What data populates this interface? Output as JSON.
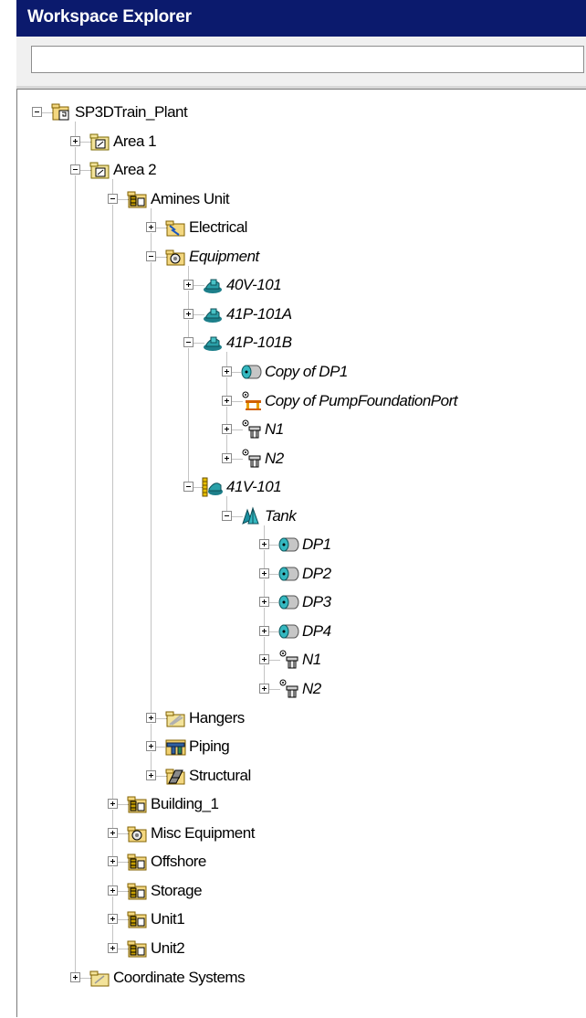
{
  "window": {
    "title": "Workspace Explorer"
  },
  "filter": {
    "value": ""
  },
  "tree": [
    {
      "label": "SP3DTrain_Plant",
      "level": 0,
      "state": "minus",
      "icon": "plant-icon",
      "italic": false
    },
    {
      "label": "Area 1",
      "level": 1,
      "state": "plus",
      "icon": "area-icon",
      "italic": false
    },
    {
      "label": "Area 2",
      "level": 1,
      "state": "minus",
      "icon": "area-icon",
      "italic": false
    },
    {
      "label": "Amines Unit",
      "level": 2,
      "state": "minus",
      "icon": "unit-icon",
      "italic": false
    },
    {
      "label": "Electrical",
      "level": 3,
      "state": "plus",
      "icon": "electrical-folder-icon",
      "italic": false
    },
    {
      "label": "Equipment",
      "level": 3,
      "state": "minus",
      "icon": "equipment-folder-icon",
      "italic": true
    },
    {
      "label": "40V-101",
      "level": 4,
      "state": "plus",
      "icon": "equipment-icon",
      "italic": true
    },
    {
      "label": "41P-101A",
      "level": 4,
      "state": "plus",
      "icon": "equipment-icon",
      "italic": true
    },
    {
      "label": "41P-101B",
      "level": 4,
      "state": "minus",
      "icon": "equipment-icon",
      "italic": true
    },
    {
      "label": "Copy of DP1",
      "level": 5,
      "state": "plus",
      "icon": "design-port-icon",
      "italic": true
    },
    {
      "label": "Copy of PumpFoundationPort",
      "level": 5,
      "state": "plus",
      "icon": "foundation-port-icon",
      "italic": true
    },
    {
      "label": "N1",
      "level": 5,
      "state": "plus",
      "icon": "nozzle-icon",
      "italic": true
    },
    {
      "label": "N2",
      "level": 5,
      "state": "plus",
      "icon": "nozzle-icon",
      "italic": true
    },
    {
      "label": "41V-101",
      "level": 4,
      "state": "minus",
      "icon": "vessel-icon",
      "italic": true
    },
    {
      "label": "Tank",
      "level": 5,
      "state": "minus",
      "icon": "tank-shape-icon",
      "italic": true
    },
    {
      "label": "DP1",
      "level": 6,
      "state": "plus",
      "icon": "design-port-icon",
      "italic": true
    },
    {
      "label": "DP2",
      "level": 6,
      "state": "plus",
      "icon": "design-port-icon",
      "italic": true
    },
    {
      "label": "DP3",
      "level": 6,
      "state": "plus",
      "icon": "design-port-icon",
      "italic": true
    },
    {
      "label": "DP4",
      "level": 6,
      "state": "plus",
      "icon": "design-port-icon",
      "italic": true
    },
    {
      "label": "N1",
      "level": 6,
      "state": "plus",
      "icon": "nozzle-icon",
      "italic": true
    },
    {
      "label": "N2",
      "level": 6,
      "state": "plus",
      "icon": "nozzle-icon",
      "italic": true
    },
    {
      "label": "Hangers",
      "level": 3,
      "state": "plus",
      "icon": "hangers-folder-icon",
      "italic": false
    },
    {
      "label": "Piping",
      "level": 3,
      "state": "plus",
      "icon": "piping-folder-icon",
      "italic": false
    },
    {
      "label": "Structural",
      "level": 3,
      "state": "plus",
      "icon": "structural-folder-icon",
      "italic": false
    },
    {
      "label": "Building_1",
      "level": 2,
      "state": "plus",
      "icon": "unit-icon",
      "italic": false
    },
    {
      "label": "Misc Equipment",
      "level": 2,
      "state": "plus",
      "icon": "equipment-folder-icon",
      "italic": false
    },
    {
      "label": "Offshore",
      "level": 2,
      "state": "plus",
      "icon": "unit-icon",
      "italic": false
    },
    {
      "label": "Storage",
      "level": 2,
      "state": "plus",
      "icon": "unit-icon",
      "italic": false
    },
    {
      "label": "Unit1",
      "level": 2,
      "state": "plus",
      "icon": "unit-icon",
      "italic": false
    },
    {
      "label": "Unit2",
      "level": 2,
      "state": "plus",
      "icon": "unit-icon",
      "italic": false
    },
    {
      "label": "Coordinate Systems",
      "level": 1,
      "state": "plus",
      "icon": "coordinate-folder-icon",
      "italic": false
    }
  ]
}
